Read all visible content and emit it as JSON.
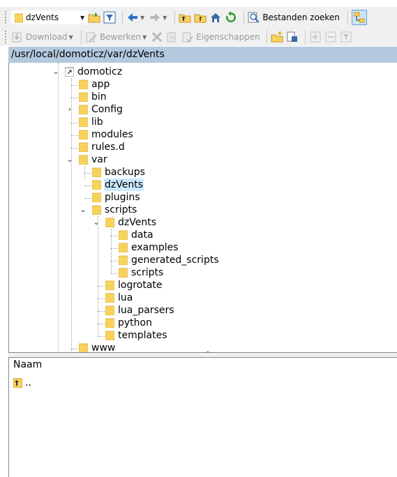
{
  "toolbar1": {
    "path_combo_value": "dzVents",
    "search_label": "Bestanden zoeken"
  },
  "toolbar2": {
    "download_label": "Download",
    "edit_label": "Bewerken",
    "properties_label": "Eigenschappen"
  },
  "path": "/usr/local/domoticz/var/dzVents",
  "tree": {
    "root": "domoticz",
    "app": "app",
    "bin": "bin",
    "config": "Config",
    "lib": "lib",
    "modules": "modules",
    "rules_d": "rules.d",
    "var": "var",
    "backups": "backups",
    "dzvents": "dzVents",
    "plugins": "plugins",
    "scripts": "scripts",
    "scripts_dzvents": "dzVents",
    "data": "data",
    "examples": "examples",
    "generated_scripts": "generated_scripts",
    "scripts_scripts": "scripts",
    "logrotate": "logrotate",
    "lua": "lua",
    "lua_parsers": "lua_parsers",
    "python": "python",
    "templates": "templates",
    "www": "www"
  },
  "list": {
    "column_name": "Naam",
    "parent_dir": ".."
  },
  "colors": {
    "folder": "#f7d35c",
    "selection": "#cce8ff",
    "pathbar": "#b4c8de",
    "toolbar": "#f0f0f0"
  }
}
